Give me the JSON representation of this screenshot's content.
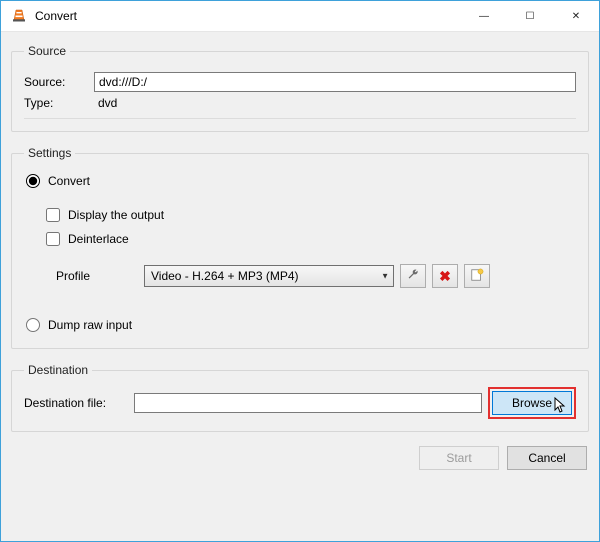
{
  "window": {
    "title": "Convert",
    "controls": {
      "minimize": "—",
      "maximize": "☐",
      "close": "✕"
    }
  },
  "source": {
    "legend": "Source",
    "source_label": "Source:",
    "source_value": "dvd:///D:/",
    "type_label": "Type:",
    "type_value": "dvd"
  },
  "settings": {
    "legend": "Settings",
    "convert_label": "Convert",
    "display_label": "Display the output",
    "deinterlace_label": "Deinterlace",
    "profile_label": "Profile",
    "profile_value": "Video - H.264 + MP3 (MP4)",
    "dump_label": "Dump raw input"
  },
  "destination": {
    "legend": "Destination",
    "file_label": "Destination file:",
    "file_value": "",
    "browse_label": "Browse"
  },
  "buttons": {
    "start": "Start",
    "cancel": "Cancel"
  },
  "icons": {
    "edit": "edit",
    "delete": "delete",
    "new": "new"
  }
}
